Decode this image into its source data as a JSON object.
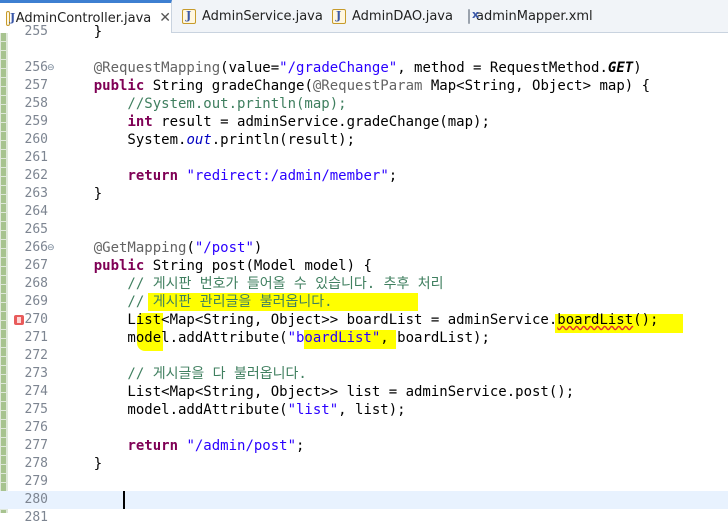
{
  "tabs": [
    {
      "label": "AdminController.java",
      "icon": "java-file-icon",
      "active": true
    },
    {
      "label": "AdminService.java",
      "icon": "java-file-icon"
    },
    {
      "label": "AdminDAO.java",
      "icon": "java-file-icon"
    },
    {
      "label": "adminMapper.xml",
      "icon": "xml-file-icon"
    }
  ],
  "tab_close": "✕",
  "code_lines": [
    {
      "n": "255",
      "text": "    }"
    },
    {
      "n": "256",
      "text": "    @RequestMapping(value=\"/gradeChange\", method = RequestMethod.GET)"
    },
    {
      "n": "257",
      "text": "    public String gradeChange(@RequestParam Map<String, Object> map) {"
    },
    {
      "n": "258",
      "text": "        //System.out.println(map);"
    },
    {
      "n": "259",
      "text": "        int result = adminService.gradeChange(map);"
    },
    {
      "n": "260",
      "text": "        System.out.println(result);"
    },
    {
      "n": "261",
      "text": ""
    },
    {
      "n": "262",
      "text": "        return \"redirect:/admin/member\";"
    },
    {
      "n": "263",
      "text": "    }"
    },
    {
      "n": "264",
      "text": ""
    },
    {
      "n": "265",
      "text": ""
    },
    {
      "n": "266",
      "text": "    @GetMapping(\"/post\")"
    },
    {
      "n": "267",
      "text": "    public String post(Model model) {"
    },
    {
      "n": "268",
      "text": "        // 게시판 번호가 들어올 수 있습니다. 추후 처리"
    },
    {
      "n": "269",
      "text": "        // 게시판 관리글을 불러옵니다."
    },
    {
      "n": "270",
      "text": "        List<Map<String, Object>> boardList = adminService.boardList();"
    },
    {
      "n": "271",
      "text": "        model.addAttribute(\"boardList\", boardList);"
    },
    {
      "n": "272",
      "text": ""
    },
    {
      "n": "273",
      "text": "        // 게시글을 다 불러옵니다."
    },
    {
      "n": "274",
      "text": "        List<Map<String, Object>> list = adminService.post();"
    },
    {
      "n": "275",
      "text": "        model.addAttribute(\"list\", list);"
    },
    {
      "n": "276",
      "text": ""
    },
    {
      "n": "277",
      "text": "        return \"/admin/post\";"
    },
    {
      "n": "278",
      "text": "    }"
    },
    {
      "n": "279",
      "text": ""
    },
    {
      "n": "280",
      "text": ""
    },
    {
      "n": "281",
      "text": ""
    }
  ],
  "colors": {
    "keyword": "#7f0055",
    "string": "#2a00ff",
    "comment": "#3f7f5f",
    "annotation": "#646464",
    "highlight": "#ffff00",
    "current_line": "#e8f2fe",
    "error_marker": "#e85b5b"
  }
}
